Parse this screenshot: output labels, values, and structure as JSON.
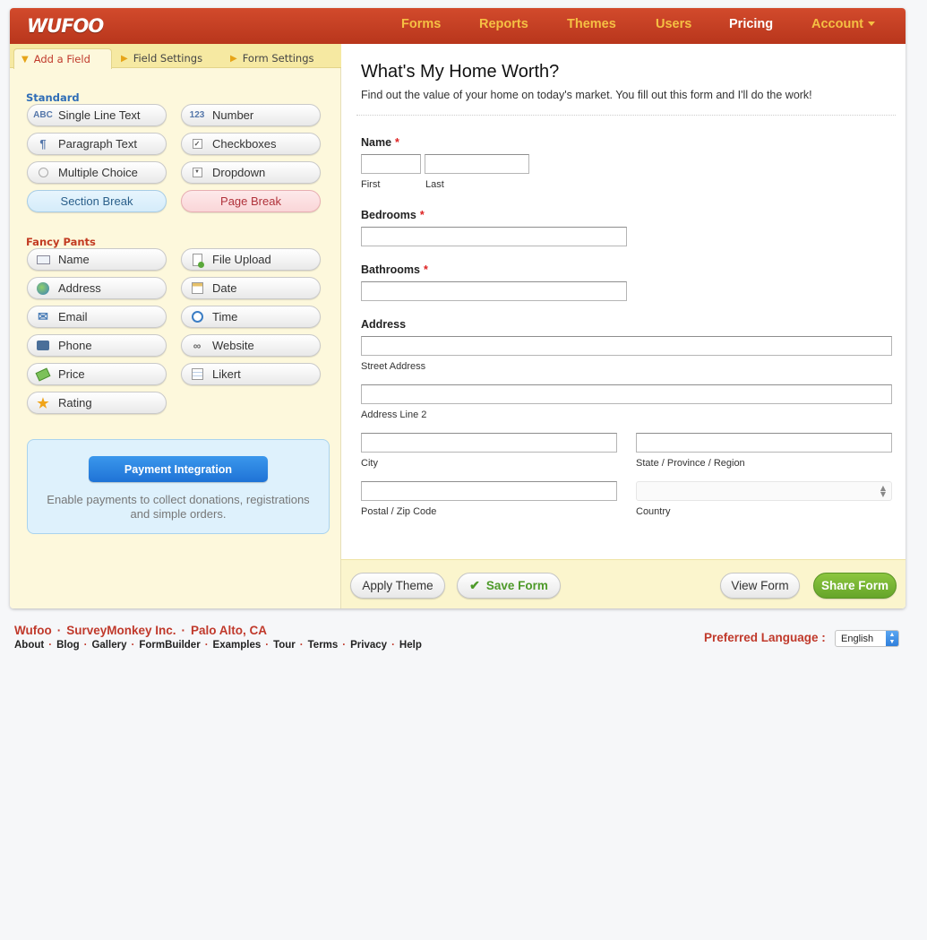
{
  "header": {
    "logo": "WUFOO",
    "nav": [
      "Forms",
      "Reports",
      "Themes",
      "Users",
      "Pricing",
      "Account"
    ]
  },
  "left_panel": {
    "tabs": [
      "Add a Field",
      "Field Settings",
      "Form Settings"
    ],
    "standard_title": "Standard",
    "standard_fields": [
      {
        "label": "Single Line Text",
        "icon": "abc-icon"
      },
      {
        "label": "Number",
        "icon": "123-icon"
      },
      {
        "label": "Paragraph Text",
        "icon": "paragraph-icon"
      },
      {
        "label": "Checkboxes",
        "icon": "checkbox-icon"
      },
      {
        "label": "Multiple Choice",
        "icon": "radio-icon"
      },
      {
        "label": "Dropdown",
        "icon": "dropdown-icon"
      },
      {
        "label": "Section Break",
        "icon": ""
      },
      {
        "label": "Page Break",
        "icon": ""
      }
    ],
    "fancy_title": "Fancy Pants",
    "fancy_fields": [
      {
        "label": "Name",
        "icon": "name-card-icon"
      },
      {
        "label": "File Upload",
        "icon": "file-upload-icon"
      },
      {
        "label": "Address",
        "icon": "globe-icon"
      },
      {
        "label": "Date",
        "icon": "calendar-icon"
      },
      {
        "label": "Email",
        "icon": "envelope-icon"
      },
      {
        "label": "Time",
        "icon": "clock-icon"
      },
      {
        "label": "Phone",
        "icon": "phone-icon"
      },
      {
        "label": "Website",
        "icon": "link-icon"
      },
      {
        "label": "Price",
        "icon": "money-icon"
      },
      {
        "label": "Likert",
        "icon": "grid-icon"
      },
      {
        "label": "Rating",
        "icon": "star-icon"
      }
    ],
    "payment": {
      "button": "Payment Integration",
      "text": "Enable payments to collect donations, registrations and simple orders."
    }
  },
  "form": {
    "title": "What's My Home Worth?",
    "description": "Find out the value of your home on today's market. You fill out this form and I'll do the work!",
    "name_label": "Name",
    "name_first": "First",
    "name_last": "Last",
    "bedrooms_label": "Bedrooms",
    "bathrooms_label": "Bathrooms",
    "address_label": "Address",
    "street": "Street Address",
    "line2": "Address Line 2",
    "city": "City",
    "state": "State / Province / Region",
    "zip": "Postal / Zip Code",
    "country": "Country",
    "required_mark": "*"
  },
  "toolbar": {
    "apply_theme": "Apply Theme",
    "save_form": "Save Form",
    "view_form": "View Form",
    "share_form": "Share Form"
  },
  "footer": {
    "company": [
      "Wufoo",
      "SurveyMonkey Inc.",
      "Palo Alto, CA"
    ],
    "links": [
      "About",
      "Blog",
      "Gallery",
      "FormBuilder",
      "Examples",
      "Tour",
      "Terms",
      "Privacy",
      "Help"
    ],
    "language_label": "Preferred Language :",
    "language_value": "English"
  },
  "colors": {
    "brand_red": "#c0392b",
    "nav_gold": "#f5c043",
    "panel_yellow": "#fdf8dc",
    "share_green": "#7ab736",
    "payment_blue": "#1f73d6"
  }
}
